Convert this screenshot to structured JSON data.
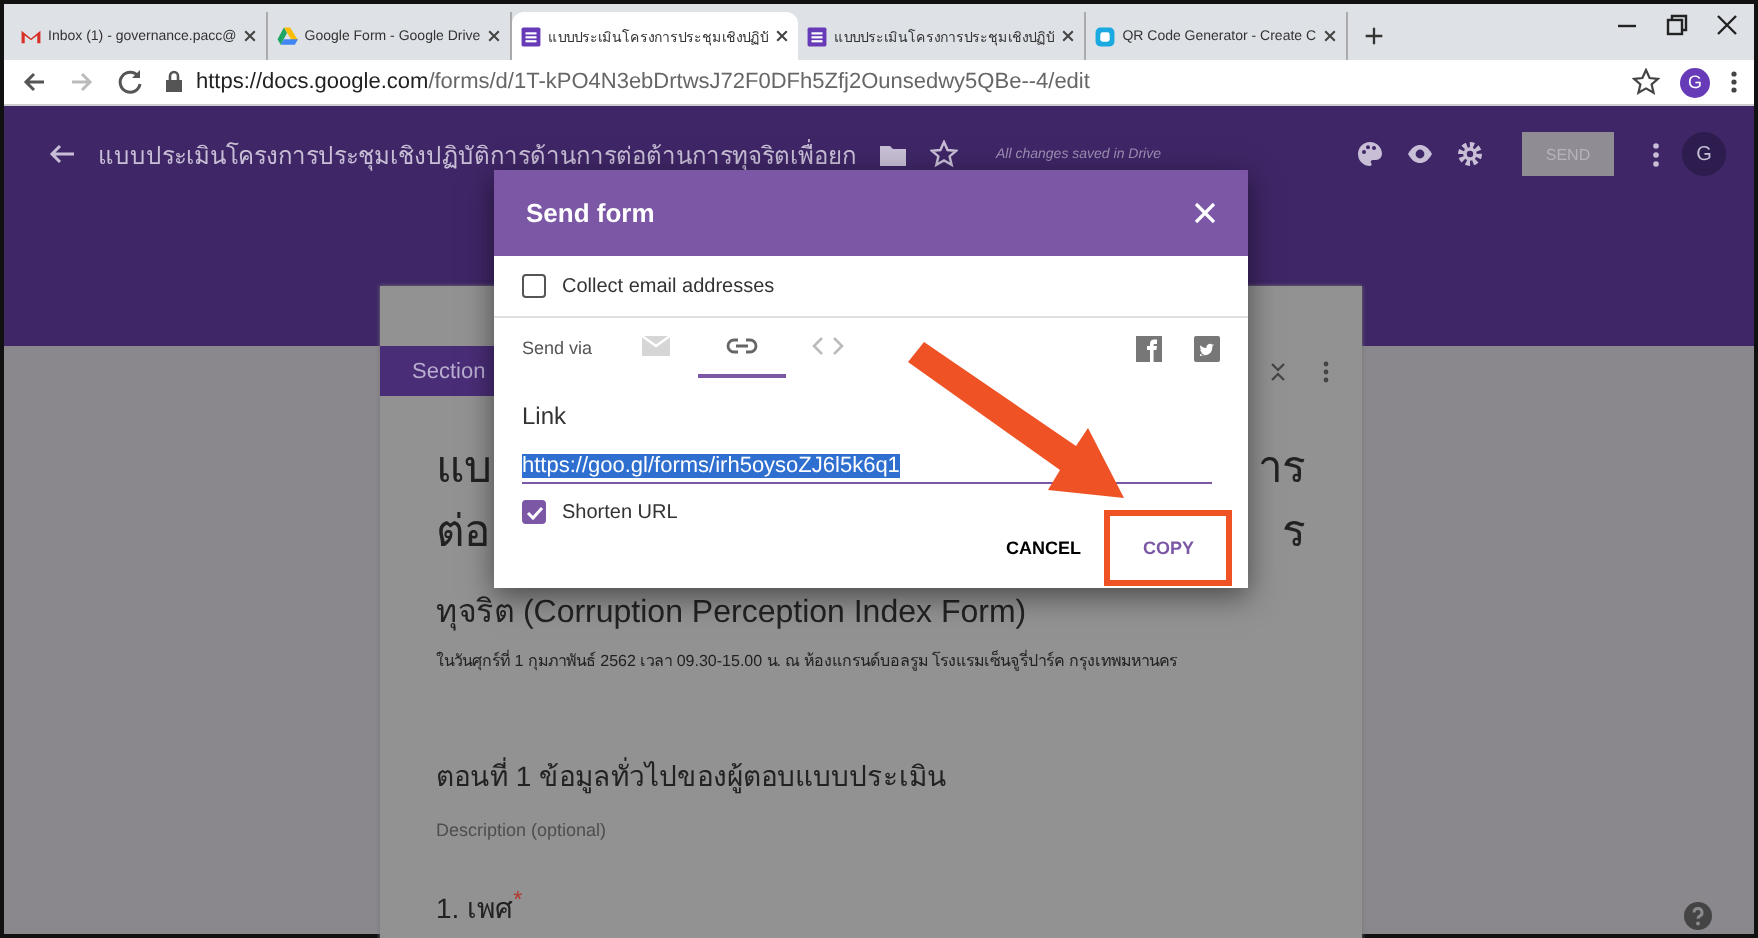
{
  "browser": {
    "tabs": [
      {
        "title": "Inbox (1) - governance.pacc@",
        "kind": "mail",
        "selected": false
      },
      {
        "title": "Google Form - Google Drive",
        "kind": "drive",
        "selected": false
      },
      {
        "title": "แบบประเมินโครงการประชุมเชิงปฏิบั",
        "kind": "forms",
        "selected": true
      },
      {
        "title": "แบบประเมินโครงการประชุมเชิงปฏิบั",
        "kind": "forms",
        "selected": false
      },
      {
        "title": "QR Code Generator - Create C",
        "kind": "qr",
        "selected": false
      }
    ],
    "url_host": "https://docs.google.com",
    "url_path": "/forms/d/1T-kPO4N3ebDrtwsJ72F0DFh5Zfj2Ounsedwy5QBe--4/edit",
    "avatar": "G"
  },
  "header": {
    "title": "แบบประเมินโครงการประชุมเชิงปฏิบัติการด้านการต่อต้านการทุจริตเพื่อยก",
    "status": "All changes saved in Drive",
    "send_button": "SEND",
    "avatar": "G"
  },
  "form": {
    "section_tab": "Section",
    "title_lines": [
      {
        "start": "แบ",
        "end": "าร"
      },
      {
        "start": "ต่อ",
        "end": "ร"
      },
      {
        "start": "ทุจริต (Corruption Perception Index Form)"
      }
    ],
    "subtitle": "ในวันศุกร์ที่ 1 กุมภาพันธ์ 2562 เวลา 09.30-15.00 น. ณ ห้องแกรนด์บอลรูม โรงแรมเซ็นจูรี่ปาร์ค กรุงเทพมหานคร",
    "section_title": "ตอนที่ 1 ข้อมูลทั่วไปของผู้ตอบแบบประเมิน",
    "description_placeholder": "Description (optional)",
    "question": "1. เพศ",
    "required_mark": "*"
  },
  "dialog": {
    "title": "Send form",
    "collect_email": {
      "label": "Collect email addresses",
      "checked": false
    },
    "send_via_label": "Send via",
    "methods": [
      {
        "kind": "email",
        "selected": false
      },
      {
        "kind": "link",
        "selected": true
      },
      {
        "kind": "embed",
        "selected": false
      }
    ],
    "link_label": "Link",
    "link_value": "https://goo.gl/forms/irh5oysoZJ6l5k6q1",
    "shorten_url": {
      "label": "Shorten URL",
      "checked": true
    },
    "cancel": "CANCEL",
    "copy": "COPY"
  }
}
